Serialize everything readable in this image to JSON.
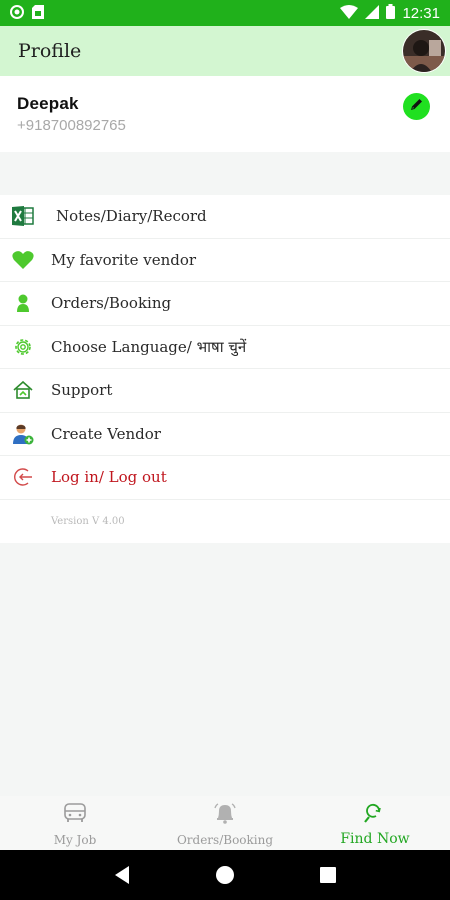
{
  "status_bar": {
    "time": "12:31",
    "left_icons": [
      "notification-circle-icon",
      "sim-card-icon"
    ],
    "right_icons": [
      "wifi-icon",
      "cellular-signal-icon",
      "battery-icon"
    ]
  },
  "app_bar": {
    "title": "Profile",
    "avatar": "user-avatar"
  },
  "profile": {
    "name": "Deepak",
    "phone": "+918700892765",
    "edit_icon": "pencil-icon"
  },
  "menu": {
    "items": [
      {
        "label": "Notes/Diary/Record",
        "icon": "excel-icon"
      },
      {
        "label": "My favorite vendor",
        "icon": "heart-icon"
      },
      {
        "label": "Orders/Booking",
        "icon": "person-icon"
      },
      {
        "label": "Choose Language/ भाषा चुनें",
        "icon": "gear-icon"
      },
      {
        "label": "Support",
        "icon": "support-house-icon"
      },
      {
        "label": "Create Vendor",
        "icon": "add-user-icon"
      },
      {
        "label": "Log in/ Log out",
        "icon": "logout-icon"
      }
    ],
    "version": "Version V 4.00"
  },
  "bottom_nav": {
    "tabs": [
      {
        "label": "My Job",
        "icon": "bus-icon",
        "active": false
      },
      {
        "label": "Orders/Booking",
        "icon": "bell-icon",
        "active": false
      },
      {
        "label": "Find Now",
        "icon": "search-refresh-icon",
        "active": true
      }
    ]
  },
  "colors": {
    "status_bar": "#20b11b",
    "app_bar": "#d3f6d1",
    "accent_green": "#22a722",
    "logout_red": "#c0161e"
  }
}
